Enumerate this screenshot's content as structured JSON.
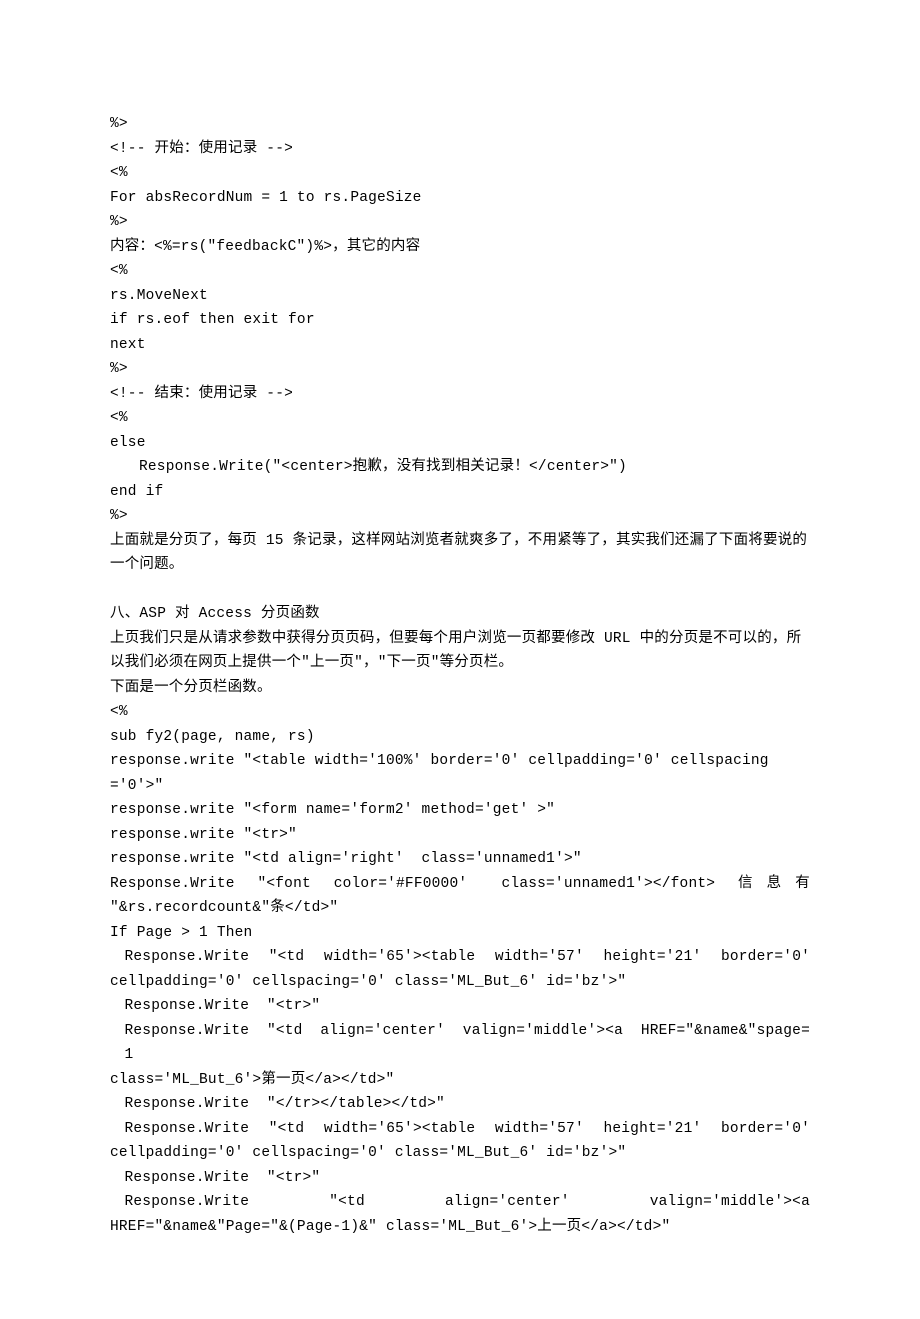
{
  "l1": "%>",
  "l2": "<!-- 开始：使用记录 -->",
  "l3": "<%",
  "l4": "For absRecordNum = 1 to rs.PageSize",
  "l5": "%>",
  "l6": "内容：<%=rs(\"feedbackC\")%>，其它的内容",
  "l7": "<%",
  "l8": "rs.MoveNext",
  "l9": "if rs.eof then exit for",
  "l10": "next",
  "l11": "%>",
  "l12": "<!-- 结束：使用记录 -->",
  "l13": "<%",
  "l14": "else",
  "l15": "Response.Write(\"<center>抱歉，没有找到相关记录！</center>\")",
  "l16": "end if",
  "l17": "%>",
  "l18": "上面就是分页了，每页 15 条记录，这样网站浏览者就爽多了，不用紧等了，其实我们还漏了下面将要说的一个问题。",
  "l19": "八、ASP 对 Access 分页函数",
  "l20": "上页我们只是从请求参数中获得分页页码，但要每个用户浏览一页都要修改 URL 中的分页是不可以的，所以我们必须在网页上提供一个\"上一页\"，\"下一页\"等分页栏。",
  "l21": "下面是一个分页栏函数。",
  "l22": "<%",
  "l23": "sub fy2(page, name, rs)",
  "l24": "response.write \"<table width='100%' border='0' cellpadding='0' cellspacing='0'>\"",
  "l25": "response.write \"<form name='form2' method='get' >\"",
  "l26": "response.write \"<tr>\"",
  "l27": "response.write \"<td align='right'  class='unnamed1'>\"",
  "l28a": "Response.Write  \"<font  color='#FF0000'   class='unnamed1'></font>  信 息 有",
  "l28b": "\"&rs.recordcount&\"条</td>\"",
  "l29": "If Page > 1 Then",
  "l30a": "Response.Write  \"<td  width='65'><table  width='57'  height='21'  border='0'",
  "l30b": "cellpadding='0' cellspacing='0' class='ML_But_6' id='bz'>\"",
  "l31": "Response.Write  \"<tr>\"",
  "l32a": "Response.Write  \"<td  align='center'  valign='middle'><a  HREF=\"&name&\"spage=1",
  "l32b": "class='ML_But_6'>第一页</a></td>\"",
  "l33": "Response.Write  \"</tr></table></td>\"",
  "l34a": "Response.Write  \"<td  width='65'><table  width='57'  height='21'  border='0'",
  "l34b": "cellpadding='0' cellspacing='0' class='ML_But_6' id='bz'>\"",
  "l35": "Response.Write  \"<tr>\"",
  "l36a": "Response.Write       \"<td       align='center'       valign='middle'><a",
  "l36b": "HREF=\"&name&\"Page=\"&(Page-1)&\" class='ML_But_6'>上一页</a></td>\""
}
